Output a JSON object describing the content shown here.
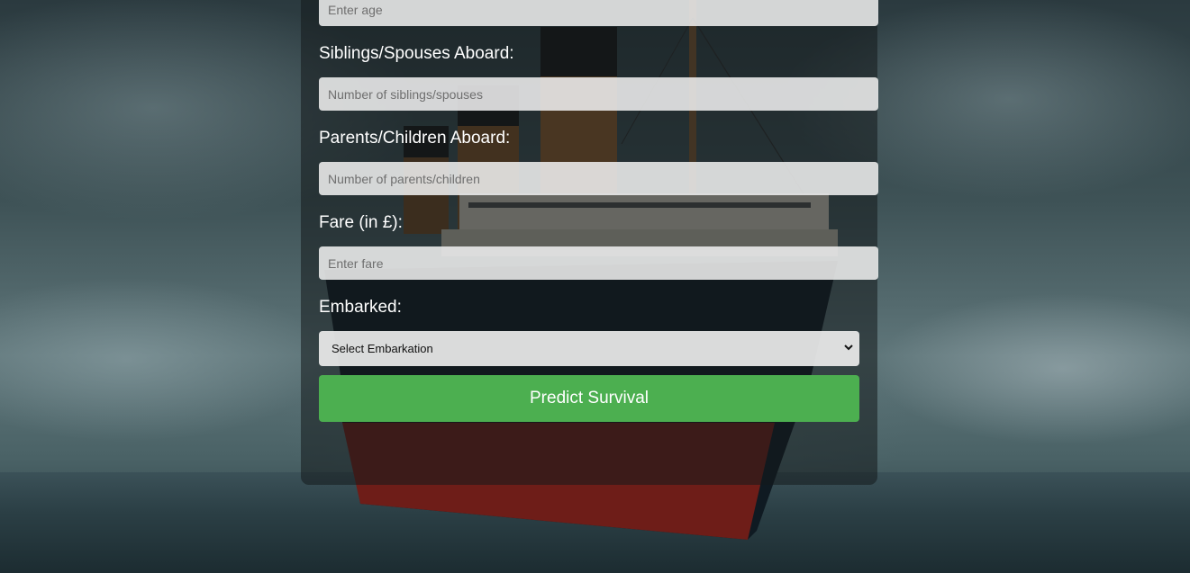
{
  "form": {
    "age": {
      "placeholder": "Enter age"
    },
    "siblings": {
      "label": "Siblings/Spouses Aboard:",
      "placeholder": "Number of siblings/spouses"
    },
    "parents": {
      "label": "Parents/Children Aboard:",
      "placeholder": "Number of parents/children"
    },
    "fare": {
      "label": "Fare (in £):",
      "placeholder": "Enter fare"
    },
    "embarked": {
      "label": "Embarked:",
      "selected": "Select Embarkation"
    },
    "submit_label": "Predict Survival"
  },
  "colors": {
    "accent": "#4caf50",
    "card_overlay": "rgba(20,25,28,0.55)"
  },
  "icons": {
    "select_arrow": "chevron-down-icon"
  }
}
